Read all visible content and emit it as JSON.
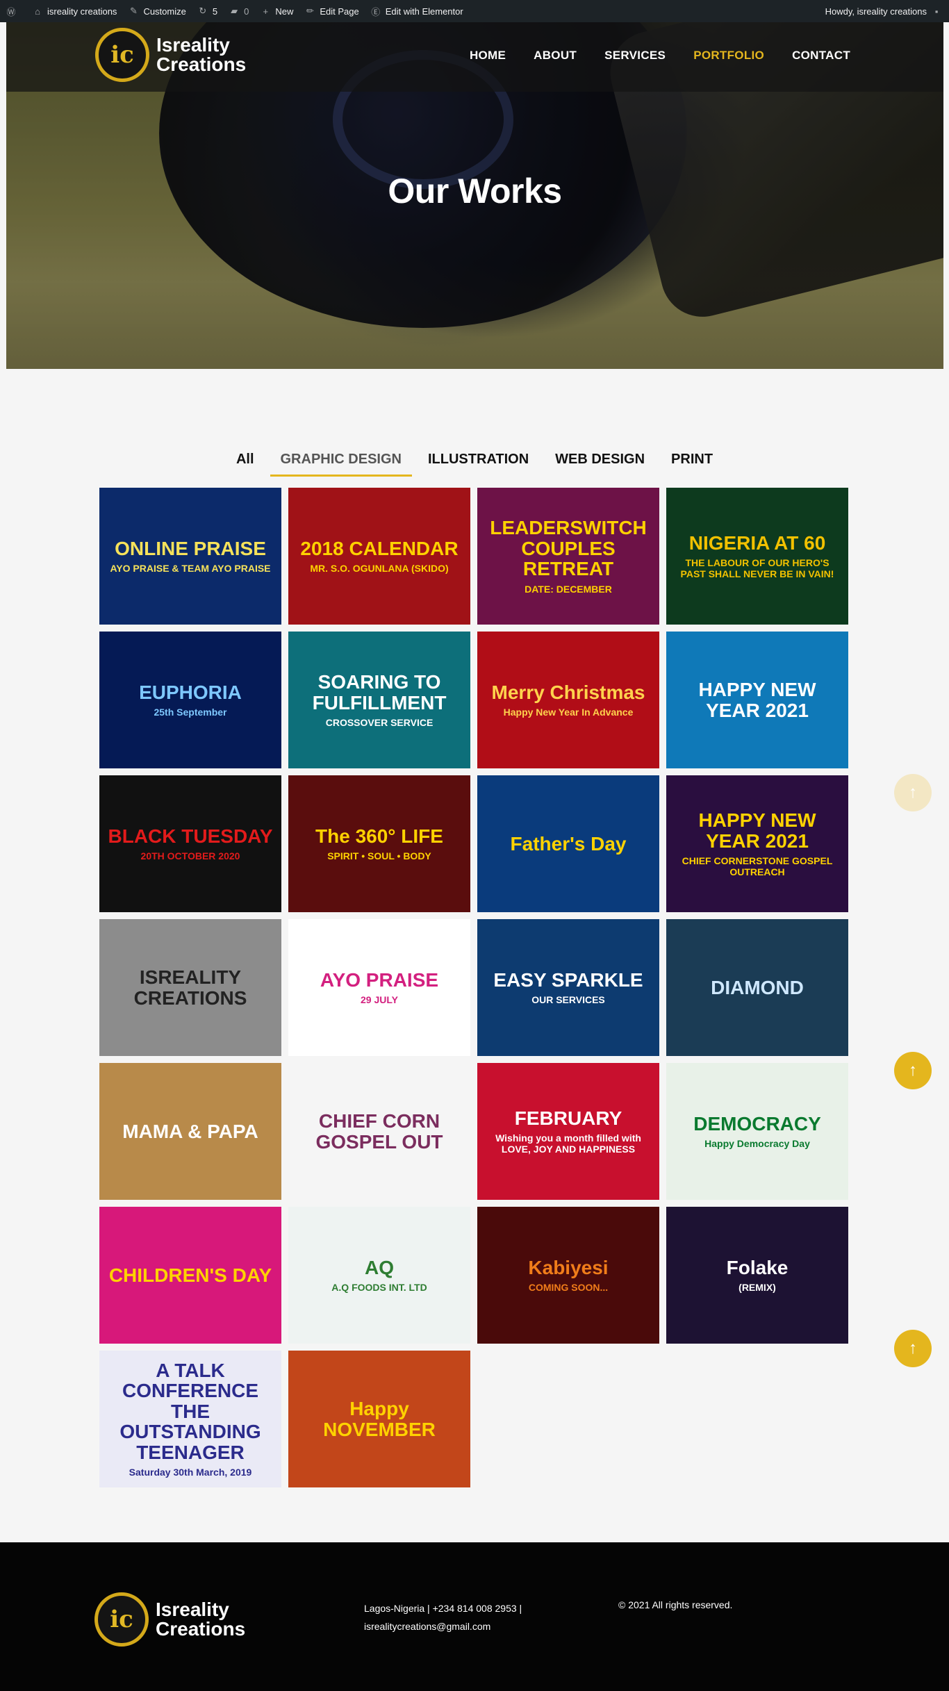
{
  "adminbar": {
    "site_name": "isreality creations",
    "customize": "Customize",
    "updates": "5",
    "comments": "0",
    "new": "New",
    "edit_page": "Edit Page",
    "elementor": "Edit with Elementor",
    "howdy": "Howdy, isreality creations"
  },
  "header": {
    "logo_line1": "Isreality",
    "logo_line2": "Creations",
    "nav": [
      "HOME",
      "ABOUT",
      "SERVICES",
      "PORTFOLIO",
      "CONTACT"
    ],
    "active": "PORTFOLIO"
  },
  "hero": {
    "title": "Our Works"
  },
  "filters": {
    "items": [
      "All",
      "GRAPHIC DESIGN",
      "ILLUSTRATION",
      "WEB DESIGN",
      "PRINT"
    ],
    "active": "GRAPHIC DESIGN"
  },
  "portfolio": [
    {
      "t1": "ONLINE PRAISE",
      "t2": "AYO PRAISE & TEAM AYO PRAISE",
      "bg": "#0c2a6a",
      "fg": "#f6e25a"
    },
    {
      "t1": "2018 CALENDAR",
      "t2": "MR. S.O. OGUNLANA (SKIDO)",
      "bg": "#a01217",
      "fg": "#ffd200"
    },
    {
      "t1": "LEADERSWITCH COUPLES RETREAT",
      "t2": "DATE: DECEMBER",
      "bg": "#6d1247",
      "fg": "#ffd200"
    },
    {
      "t1": "NIGERIA AT 60",
      "t2": "THE LABOUR OF OUR HERO'S PAST SHALL NEVER BE IN VAIN!",
      "bg": "#0d3a1e",
      "fg": "#f2c100"
    },
    {
      "t1": "EUPHORIA",
      "t2": "25th September",
      "bg": "#051a55",
      "fg": "#7ec8ff"
    },
    {
      "t1": "SOARING TO FULFILLMENT",
      "t2": "CROSSOVER SERVICE",
      "bg": "#0d6f7a",
      "fg": "#ffffff"
    },
    {
      "t1": "Merry Christmas",
      "t2": "Happy New Year In Advance",
      "bg": "#b10d17",
      "fg": "#ffd34d"
    },
    {
      "t1": "HAPPY NEW YEAR 2021",
      "t2": "",
      "bg": "#0f79b8",
      "fg": "#ffffff"
    },
    {
      "t1": "BLACK TUESDAY",
      "t2": "20TH OCTOBER 2020",
      "bg": "#111111",
      "fg": "#e21b1b"
    },
    {
      "t1": "The 360° LIFE",
      "t2": "SPIRIT • SOUL • BODY",
      "bg": "#5a0d0d",
      "fg": "#ffd200"
    },
    {
      "t1": "Father's Day",
      "t2": "",
      "bg": "#0a3b7c",
      "fg": "#ffd200"
    },
    {
      "t1": "HAPPY NEW YEAR 2021",
      "t2": "CHIEF CORNERSTONE GOSPEL OUTREACH",
      "bg": "#2a0e3f",
      "fg": "#ffd200"
    },
    {
      "t1": "ISREALITY CREATIONS",
      "t2": "",
      "bg": "#8c8c8c",
      "fg": "#222222"
    },
    {
      "t1": "AYO PRAISE",
      "t2": "29 JULY",
      "bg": "#ffffff",
      "fg": "#d3207f"
    },
    {
      "t1": "EASY SPARKLE",
      "t2": "OUR SERVICES",
      "bg": "#0d3b70",
      "fg": "#ffffff"
    },
    {
      "t1": "DIAMOND",
      "t2": "",
      "bg": "#1b3c55",
      "fg": "#cfe8ff"
    },
    {
      "t1": "MAMA & PAPA",
      "t2": "",
      "bg": "#b88a4a",
      "fg": "#ffffff"
    },
    {
      "t1": "CHIEF CORN GOSPEL OUT",
      "t2": "",
      "bg": "#f5f5f5",
      "fg": "#7b2d5e"
    },
    {
      "t1": "FEBRUARY",
      "t2": "Wishing you a month filled with LOVE, JOY AND HAPPINESS",
      "bg": "#c8102e",
      "fg": "#ffffff"
    },
    {
      "t1": "DEMOCRACY",
      "t2": "Happy Democracy Day",
      "bg": "#e8f1e8",
      "fg": "#0a7a2f"
    },
    {
      "t1": "CHILDREN'S DAY",
      "t2": "",
      "bg": "#d7187a",
      "fg": "#ffd200"
    },
    {
      "t1": "AQ",
      "t2": "A.Q FOODS INT. LTD",
      "bg": "#eef3f2",
      "fg": "#2e7d32"
    },
    {
      "t1": "Kabiyesi",
      "t2": "COMING SOON...",
      "bg": "#4a0a0a",
      "fg": "#f07d1a"
    },
    {
      "t1": "Folake",
      "t2": "(REMIX)",
      "bg": "#1d1233",
      "fg": "#ffffff"
    },
    {
      "t1": "A TALK CONFERENCE THE OUTSTANDING TEENAGER",
      "t2": "Saturday 30th March, 2019",
      "bg": "#eaeaf6",
      "fg": "#2b2b8c"
    },
    {
      "t1": "Happy NOVEMBER",
      "t2": "",
      "bg": "#c2461a",
      "fg": "#ffd200"
    }
  ],
  "totop": [
    {
      "color": "#f3e7c4"
    },
    {
      "color": "#e4b61e"
    },
    {
      "color": "#e4b61e"
    }
  ],
  "footer": {
    "logo_line1": "Isreality",
    "logo_line2": "Creations",
    "address": "Lagos-Nigeria | +234 814 008 2953 |",
    "email": "isrealitycreations@gmail.com",
    "copyright": "© 2021 All rights reserved."
  }
}
